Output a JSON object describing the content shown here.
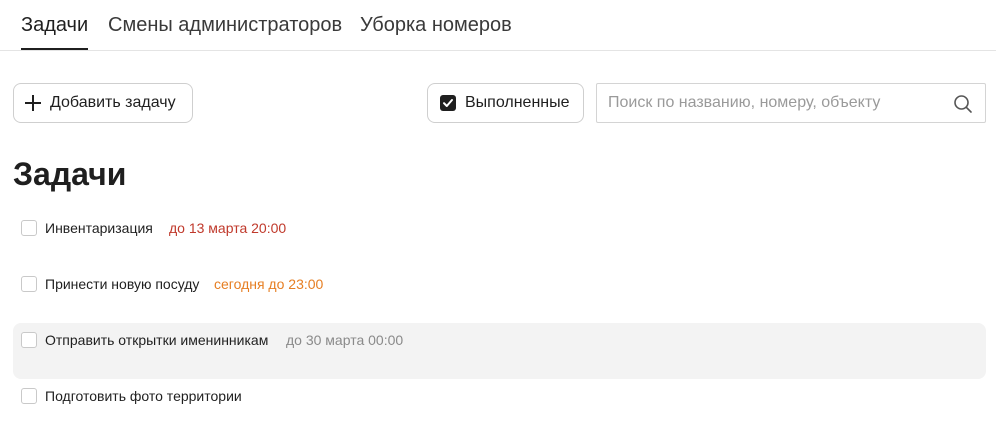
{
  "tabs": [
    {
      "label": "Задачи",
      "active": true
    },
    {
      "label": "Смены администраторов",
      "active": false
    },
    {
      "label": "Уборка номеров",
      "active": false
    }
  ],
  "toolbar": {
    "add_label": "Добавить задачу",
    "done_label": "Выполненные",
    "done_checked": true,
    "search_placeholder": "Поиск по названию, номеру, объекту",
    "search_value": ""
  },
  "page_title": "Задачи",
  "tasks": [
    {
      "name": "Инвентаризация",
      "due": "до 13 марта 20:00",
      "due_color": "#c0392b"
    },
    {
      "name": "Принести новую посуду",
      "due": "сегодня до 23:00",
      "due_color": "#e67e22"
    },
    {
      "name": "Отправить открытки именинникам",
      "due": "до 30 марта 00:00",
      "due_color": "#8a8a8a"
    },
    {
      "name": "Подготовить фото территории",
      "due": "",
      "due_color": "#8a8a8a"
    }
  ],
  "icons": {
    "add": "plus-icon",
    "done": "checkbox-checked-icon",
    "search": "search-icon"
  }
}
